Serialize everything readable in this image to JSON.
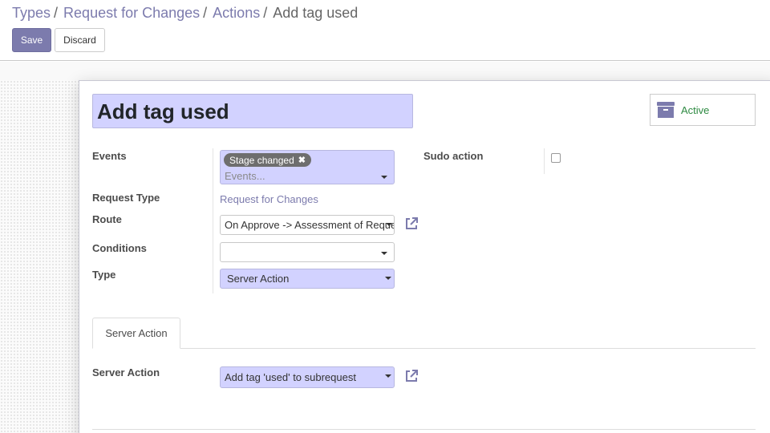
{
  "breadcrumb": {
    "items": [
      "Types",
      "Request for Changes",
      "Actions"
    ],
    "current": "Add tag used"
  },
  "toolbar": {
    "save_label": "Save",
    "discard_label": "Discard"
  },
  "form": {
    "title": "Add tag used",
    "active_label": "Active",
    "events": {
      "label": "Events",
      "tag": "Stage changed",
      "placeholder": "Events..."
    },
    "sudo_action": {
      "label": "Sudo action",
      "checked": false
    },
    "request_type": {
      "label": "Request Type",
      "value": "Request for Changes"
    },
    "route": {
      "label": "Route",
      "value": "On Approve -> Assessment of Request"
    },
    "conditions": {
      "label": "Conditions",
      "value": ""
    },
    "type": {
      "label": "Type",
      "value": "Server Action"
    }
  },
  "tabs": [
    {
      "label": "Server Action",
      "active": true
    }
  ],
  "server_action": {
    "label": "Server Action",
    "value": "Add tag 'used' to subrequest"
  },
  "colors": {
    "accent": "#7c7bad",
    "required_bg": "#d2d2ff",
    "active_green": "#2e8a42"
  }
}
